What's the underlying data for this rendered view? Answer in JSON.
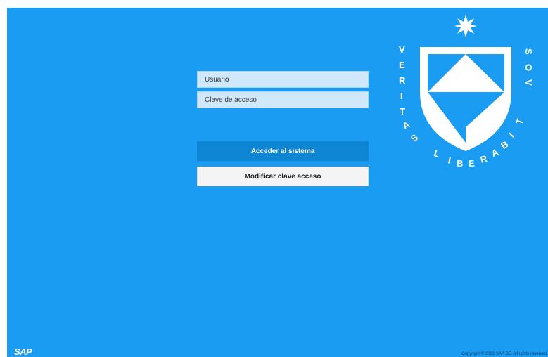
{
  "login": {
    "username_placeholder": "Usuario",
    "password_placeholder": "Clave de acceso",
    "login_button": "Acceder al sistema",
    "change_password_button": "Modificar clave acceso"
  },
  "crest": {
    "motto": "VERITAS LIBERABIT VOS"
  },
  "footer": {
    "logo": "SAP",
    "copyright": "Copyright © 2022 SAP SE. All rights reserved."
  },
  "colors": {
    "background": "#1a9cf2",
    "input": "#cfe8fb",
    "login_button": "#0e86d4",
    "change_button": "#f4f4f4"
  }
}
